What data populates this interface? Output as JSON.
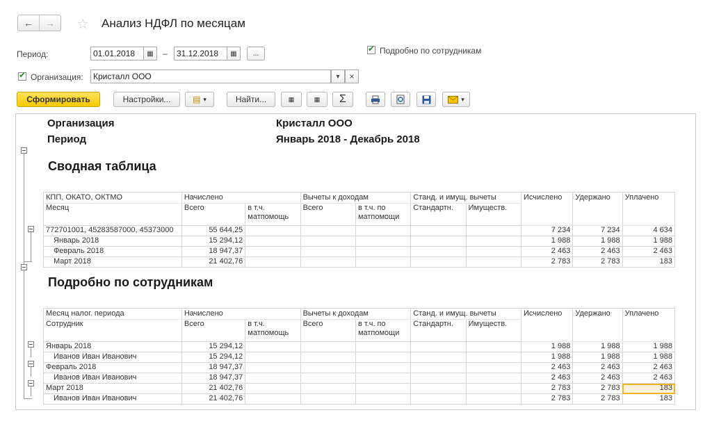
{
  "window": {
    "title": "Анализ НДФЛ по месяцам"
  },
  "nav": {
    "back": "←",
    "forward": "→",
    "star": "☆"
  },
  "filters": {
    "period_label": "Период:",
    "date_from": "01.01.2018",
    "dash": "–",
    "date_to": "31.12.2018",
    "dots": "...",
    "detail_label": "Подробно по сотрудникам",
    "org_label": "Организация:",
    "org_value": "Кристалл ООО",
    "dropdown": "▾",
    "clear": "×"
  },
  "toolbar": {
    "generate": "Сформировать",
    "settings": "Настройки...",
    "find": "Найти...",
    "sigma": "Σ"
  },
  "report": {
    "org_label": "Организация",
    "org_value": "Кристалл ООО",
    "period_label": "Период",
    "period_value": "Январь 2018 - Декабрь 2018",
    "summary_title": "Сводная таблица",
    "detail_title": "Подробно по сотрудникам",
    "headers1": {
      "c1a": "КПП, ОКАТО, ОКТМО",
      "c1b": "Месяц",
      "accrued": "Начислено",
      "total": "Всего",
      "incl_aid_1": "в т.ч.",
      "incl_aid_2": "матпомощь",
      "deductions": "Вычеты к доходам",
      "d_total": "Всего",
      "d_incl_1": "в т.ч. по",
      "d_incl_2": "матпомощи",
      "std_prop": "Станд. и имущ. вычеты",
      "std": "Стандартн.",
      "prop": "Имуществ.",
      "calc": "Исчислено",
      "withheld": "Удержано",
      "paid": "Уплачено"
    },
    "headers2": {
      "c1a": "Месяц налог. периода",
      "c1b": "Сотрудник"
    },
    "summary_rows": [
      {
        "name": "772701001, 45283587000, 45373000",
        "accrued": "55 644,25",
        "calc": "7 234",
        "withheld": "7 234",
        "paid": "4 634"
      },
      {
        "name": "Январь 2018",
        "accrued": "15 294,12",
        "calc": "1 988",
        "withheld": "1 988",
        "paid": "1 988"
      },
      {
        "name": "Февраль 2018",
        "accrued": "18 947,37",
        "calc": "2 463",
        "withheld": "2 463",
        "paid": "2 463"
      },
      {
        "name": "Март 2018",
        "accrued": "21 402,76",
        "calc": "2 783",
        "withheld": "2 783",
        "paid": "183"
      }
    ],
    "detail_rows": [
      {
        "name": "Январь 2018",
        "accrued": "15 294,12",
        "calc": "1 988",
        "withheld": "1 988",
        "paid": "1 988"
      },
      {
        "name": "Иванов Иван Иванович",
        "accrued": "15 294,12",
        "calc": "1 988",
        "withheld": "1 988",
        "paid": "1 988"
      },
      {
        "name": "Февраль 2018",
        "accrued": "18 947,37",
        "calc": "2 463",
        "withheld": "2 463",
        "paid": "2 463"
      },
      {
        "name": "Иванов Иван Иванович",
        "accrued": "18 947,37",
        "calc": "2 463",
        "withheld": "2 463",
        "paid": "2 463"
      },
      {
        "name": "Март 2018",
        "accrued": "21 402,76",
        "calc": "2 783",
        "withheld": "2 783",
        "paid": "183"
      },
      {
        "name": "Иванов Иван Иванович",
        "accrued": "21 402,76",
        "calc": "2 783",
        "withheld": "2 783",
        "paid": "183"
      }
    ]
  },
  "colors": {
    "accent": "#f5c800",
    "selection": "#f0b429",
    "check": "#2d8a2d"
  }
}
